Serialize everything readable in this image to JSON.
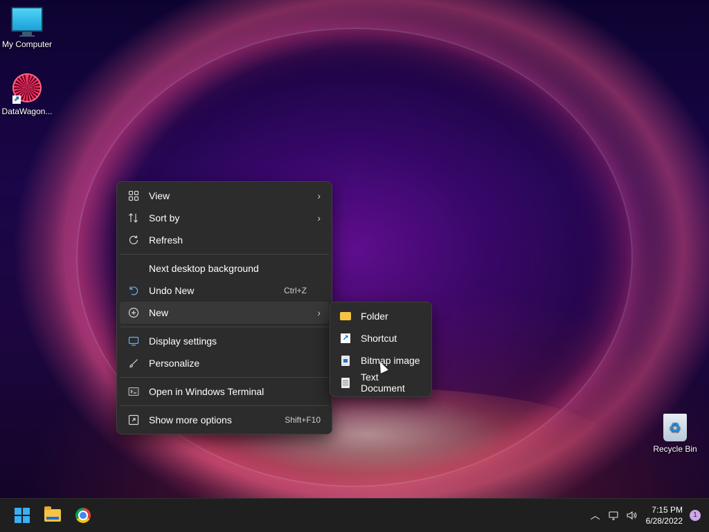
{
  "desktop": {
    "icons": [
      {
        "label": "My Computer",
        "icon": "computer-icon"
      },
      {
        "label": "DataWagon...",
        "icon": "datawagon-shortcut-icon"
      },
      {
        "label": "Recycle Bin",
        "icon": "recycle-bin-icon"
      }
    ]
  },
  "context_menu": {
    "items": [
      {
        "label": "View",
        "icon": "grid-icon",
        "arrow": "›"
      },
      {
        "label": "Sort by",
        "icon": "sort-icon",
        "arrow": "›"
      },
      {
        "label": "Refresh",
        "icon": "refresh-icon"
      },
      {
        "label": "Next desktop background"
      },
      {
        "label": "Undo New",
        "icon": "undo-icon",
        "shortcut": "Ctrl+Z"
      },
      {
        "label": "New",
        "icon": "new-plus-icon",
        "arrow": "›"
      },
      {
        "label": "Display settings",
        "icon": "display-icon"
      },
      {
        "label": "Personalize",
        "icon": "brush-icon"
      },
      {
        "label": "Open in Windows Terminal",
        "icon": "terminal-icon"
      },
      {
        "label": "Show more options",
        "icon": "more-options-icon",
        "shortcut": "Shift+F10"
      }
    ]
  },
  "submenu_new": {
    "items": [
      {
        "label": "Folder",
        "icon": "folder-icon"
      },
      {
        "label": "Shortcut",
        "icon": "shortcut-icon"
      },
      {
        "label": "Bitmap image",
        "icon": "bitmap-icon"
      },
      {
        "label": "Text Document",
        "icon": "text-document-icon"
      }
    ]
  },
  "taskbar": {
    "apps": [
      {
        "name": "start",
        "icon": "windows-start-icon"
      },
      {
        "name": "file-explorer",
        "icon": "file-explorer-icon"
      },
      {
        "name": "chrome",
        "icon": "chrome-icon"
      }
    ],
    "tray": {
      "chevron": "︿",
      "time": "7:15 PM",
      "date": "6/28/2022",
      "notification_count": "1"
    }
  }
}
